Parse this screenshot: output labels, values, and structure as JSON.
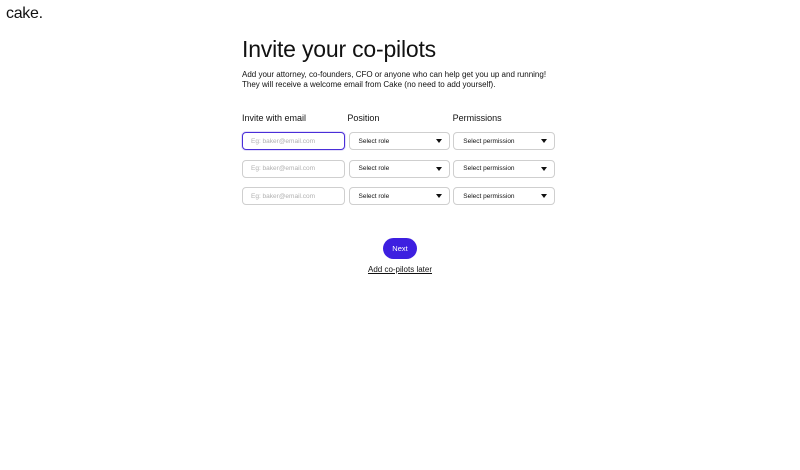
{
  "brand": {
    "logo_text": "cake."
  },
  "page": {
    "title": "Invite your co-pilots",
    "subtitle_line1": "Add your attorney, co-founders, CFO or anyone who can help get you up and running!",
    "subtitle_line2": "They will receive a welcome email from Cake (no need to add yourself)."
  },
  "form": {
    "headers": {
      "email": "Invite with email",
      "position": "Position",
      "permissions": "Permissions"
    },
    "rows": [
      {
        "email_value": "",
        "email_placeholder": "Eg: baker@email.com",
        "role": "Select role",
        "permission": "Select permission",
        "focused": true
      },
      {
        "email_value": "",
        "email_placeholder": "Eg: baker@email.com",
        "role": "Select role",
        "permission": "Select permission",
        "focused": false
      },
      {
        "email_value": "",
        "email_placeholder": "Eg: baker@email.com",
        "role": "Select role",
        "permission": "Select permission",
        "focused": false
      }
    ]
  },
  "actions": {
    "next_label": "Next",
    "later_label": "Add co-pilots later"
  },
  "colors": {
    "accent": "#3d1fe0",
    "focus_border": "#4a2ed8",
    "input_border": "#cfcfcf",
    "text": "#111111",
    "placeholder": "#b0b0b0"
  },
  "icons": {
    "dropdown": "caret-down-icon"
  }
}
